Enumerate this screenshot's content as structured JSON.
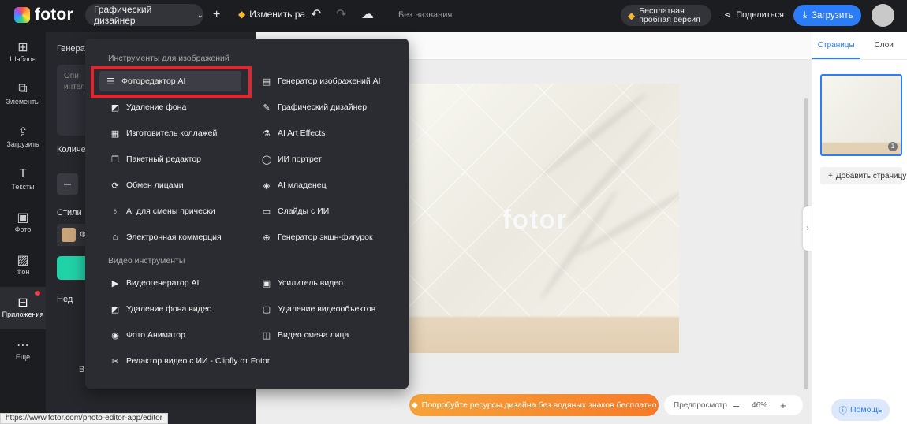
{
  "topbar": {
    "logo_text": "fotor",
    "mode_label": "Графический дизайнер",
    "resize_label": "Изменить ра",
    "doc_title": "Без названия",
    "trial_line1": "Бесплатная",
    "trial_line2": "пробная версия",
    "share_label": "Поделиться",
    "download_label": "Загрузить"
  },
  "rail": {
    "items": [
      {
        "icon": "⊞",
        "label": "Шаблон"
      },
      {
        "icon": "⧉",
        "label": "Элементы"
      },
      {
        "icon": "⇪",
        "label": "Загрузить"
      },
      {
        "icon": "T",
        "label": "Тексты"
      },
      {
        "icon": "▣",
        "label": "Фото"
      },
      {
        "icon": "▨",
        "label": "Фон"
      },
      {
        "icon": "⊟",
        "label": "Приложения"
      },
      {
        "icon": "⋯",
        "label": "Еще"
      }
    ]
  },
  "panel": {
    "title": "Генерато",
    "prompt_text": "Опи\nинтел",
    "count_label": "Количес",
    "minus": "–",
    "styles_label": "Стили",
    "style_card": "Ф",
    "link_label": "Нед",
    "bottom_text": "В"
  },
  "dropdown": {
    "image_tools_title": "Инструменты для изображений",
    "video_tools_title": "Видео инструменты",
    "image_tools_left": [
      {
        "icon": "☰",
        "label": "Фоторедактор AI"
      },
      {
        "icon": "◩",
        "label": "Удаление фона"
      },
      {
        "icon": "▦",
        "label": "Изготовитель коллажей"
      },
      {
        "icon": "❐",
        "label": "Пакетный редактор"
      },
      {
        "icon": "⟳",
        "label": "Обмен лицами"
      },
      {
        "icon": "♁",
        "label": "AI для смены прически"
      },
      {
        "icon": "⌂",
        "label": "Электронная коммерция"
      }
    ],
    "image_tools_right": [
      {
        "icon": "▤",
        "label": "Генератор изображений AI"
      },
      {
        "icon": "✎",
        "label": "Графический дизайнер"
      },
      {
        "icon": "⚗",
        "label": "AI Art Effects"
      },
      {
        "icon": "◯",
        "label": "ИИ портрет"
      },
      {
        "icon": "◈",
        "label": "AI младенец"
      },
      {
        "icon": "▭",
        "label": "Слайды с ИИ"
      },
      {
        "icon": "⊕",
        "label": "Генератор экшн-фигурок"
      }
    ],
    "video_tools_left": [
      {
        "icon": "▶",
        "label": "Видеогенератор AI"
      },
      {
        "icon": "◩",
        "label": "Удаление фона видео"
      },
      {
        "icon": "◉",
        "label": "Фото Аниматор"
      },
      {
        "icon": "✂",
        "label": "Редактор видео с ИИ - Clipfly от Fotor"
      }
    ],
    "video_tools_right": [
      {
        "icon": "▣",
        "label": "Усилитель видео"
      },
      {
        "icon": "▢",
        "label": "Удаление видеообъектов"
      },
      {
        "icon": "◫",
        "label": "Видео смена лица"
      }
    ]
  },
  "canvas": {
    "watermark": "fotor",
    "promo_label": "Попробуйте ресурсы дизайна без водяных знаков бесплатно",
    "preview_label": "Предпросмотр",
    "zoom_value": "46%",
    "zoom_minus": "–",
    "zoom_plus": "+"
  },
  "right_panel": {
    "tab_pages": "Страницы",
    "tab_layers": "Слои",
    "page_number": "1",
    "add_page_label": "Добавить страницу"
  },
  "help_label": "Помощь",
  "status_url": "https://www.fotor.com/photo-editor-app/editor",
  "colors": {
    "accent": "#2b7cf7",
    "highlight_frame": "#e0262d",
    "promo": "#f7902f",
    "dark_bg": "#1c1d21"
  }
}
